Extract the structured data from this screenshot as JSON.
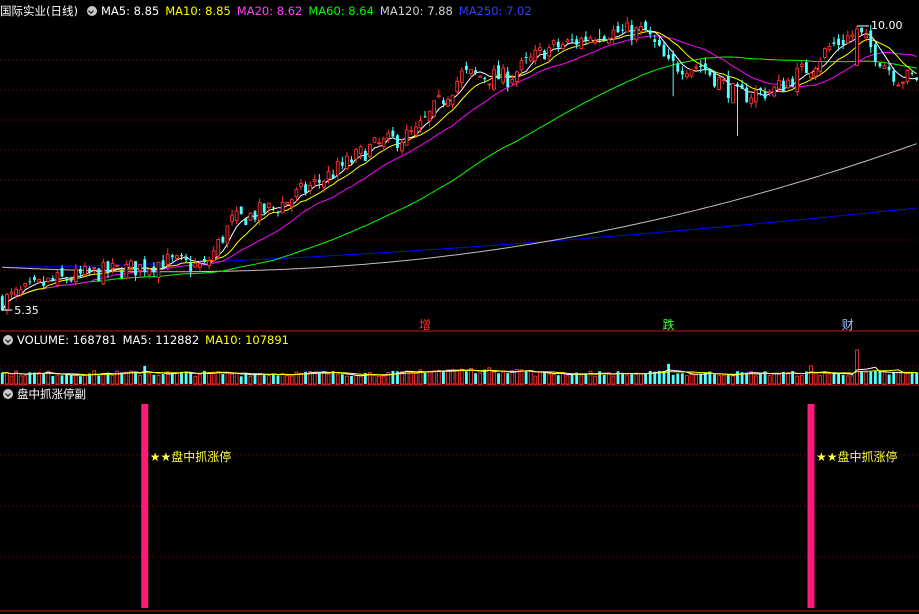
{
  "main_header": {
    "title": "国际实业(日线)",
    "ma5": "MA5: 8.85",
    "ma10": "MA10: 8.85",
    "ma20": "MA20: 8.62",
    "ma60": "MA60: 8.64",
    "ma120": "MA120: 7.88",
    "ma250": "MA250: 7.02"
  },
  "volume_header": {
    "volume": "VOLUME: 168781",
    "ma5": "MA5: 112882",
    "ma10": "MA10: 107891"
  },
  "indicator_header": {
    "title": "盘中抓涨停副"
  },
  "labels": {
    "high": "10.00",
    "low": "5.35"
  },
  "markers": [
    {
      "text": "增",
      "index": 92,
      "color": "#ff3030"
    },
    {
      "text": "跌",
      "index": 145,
      "color": "#40ff40"
    },
    {
      "text": "财",
      "index": 184,
      "color": "#a0c8ff"
    }
  ],
  "signals": [
    {
      "index": 31,
      "text": "★★盘中抓涨停"
    },
    {
      "index": 176,
      "text": "★★盘中抓涨停"
    }
  ],
  "colors": {
    "up": "#ff3232",
    "down": "#54ffff",
    "ma5": "#ffffff",
    "ma10": "#ffff00",
    "ma20": "#ff00ff",
    "ma60": "#00ff00",
    "ma120": "#c0c0c0",
    "ma250": "#0000ff",
    "signal": "#ff1a7a",
    "grid": "#8a1010"
  },
  "chart_data": {
    "type": "candlestick",
    "count": 200,
    "price_range": [
      5.35,
      10.0
    ],
    "start_close": 5.5,
    "anchors": [
      [
        0,
        5.5
      ],
      [
        10,
        5.8
      ],
      [
        20,
        5.95
      ],
      [
        30,
        6.05
      ],
      [
        35,
        6.15
      ],
      [
        44,
        6.05
      ],
      [
        50,
        6.8
      ],
      [
        60,
        7.05
      ],
      [
        70,
        7.5
      ],
      [
        80,
        8.0
      ],
      [
        90,
        8.25
      ],
      [
        100,
        9.2
      ],
      [
        110,
        9.15
      ],
      [
        118,
        9.6
      ],
      [
        125,
        9.75
      ],
      [
        130,
        9.9
      ],
      [
        140,
        9.9
      ],
      [
        145,
        9.35
      ],
      [
        152,
        9.35
      ],
      [
        160,
        8.85
      ],
      [
        168,
        8.95
      ],
      [
        176,
        9.35
      ],
      [
        180,
        9.65
      ],
      [
        186,
        9.9
      ],
      [
        190,
        9.55
      ],
      [
        195,
        9.15
      ],
      [
        199,
        9.15
      ]
    ],
    "volume_max": 168781,
    "ma_values": {
      "MA5": 8.85,
      "MA10": 8.85,
      "MA20": 8.62,
      "MA60": 8.64,
      "MA120": 7.88,
      "MA250": 7.02
    },
    "signal_indices": [
      31,
      176
    ]
  }
}
